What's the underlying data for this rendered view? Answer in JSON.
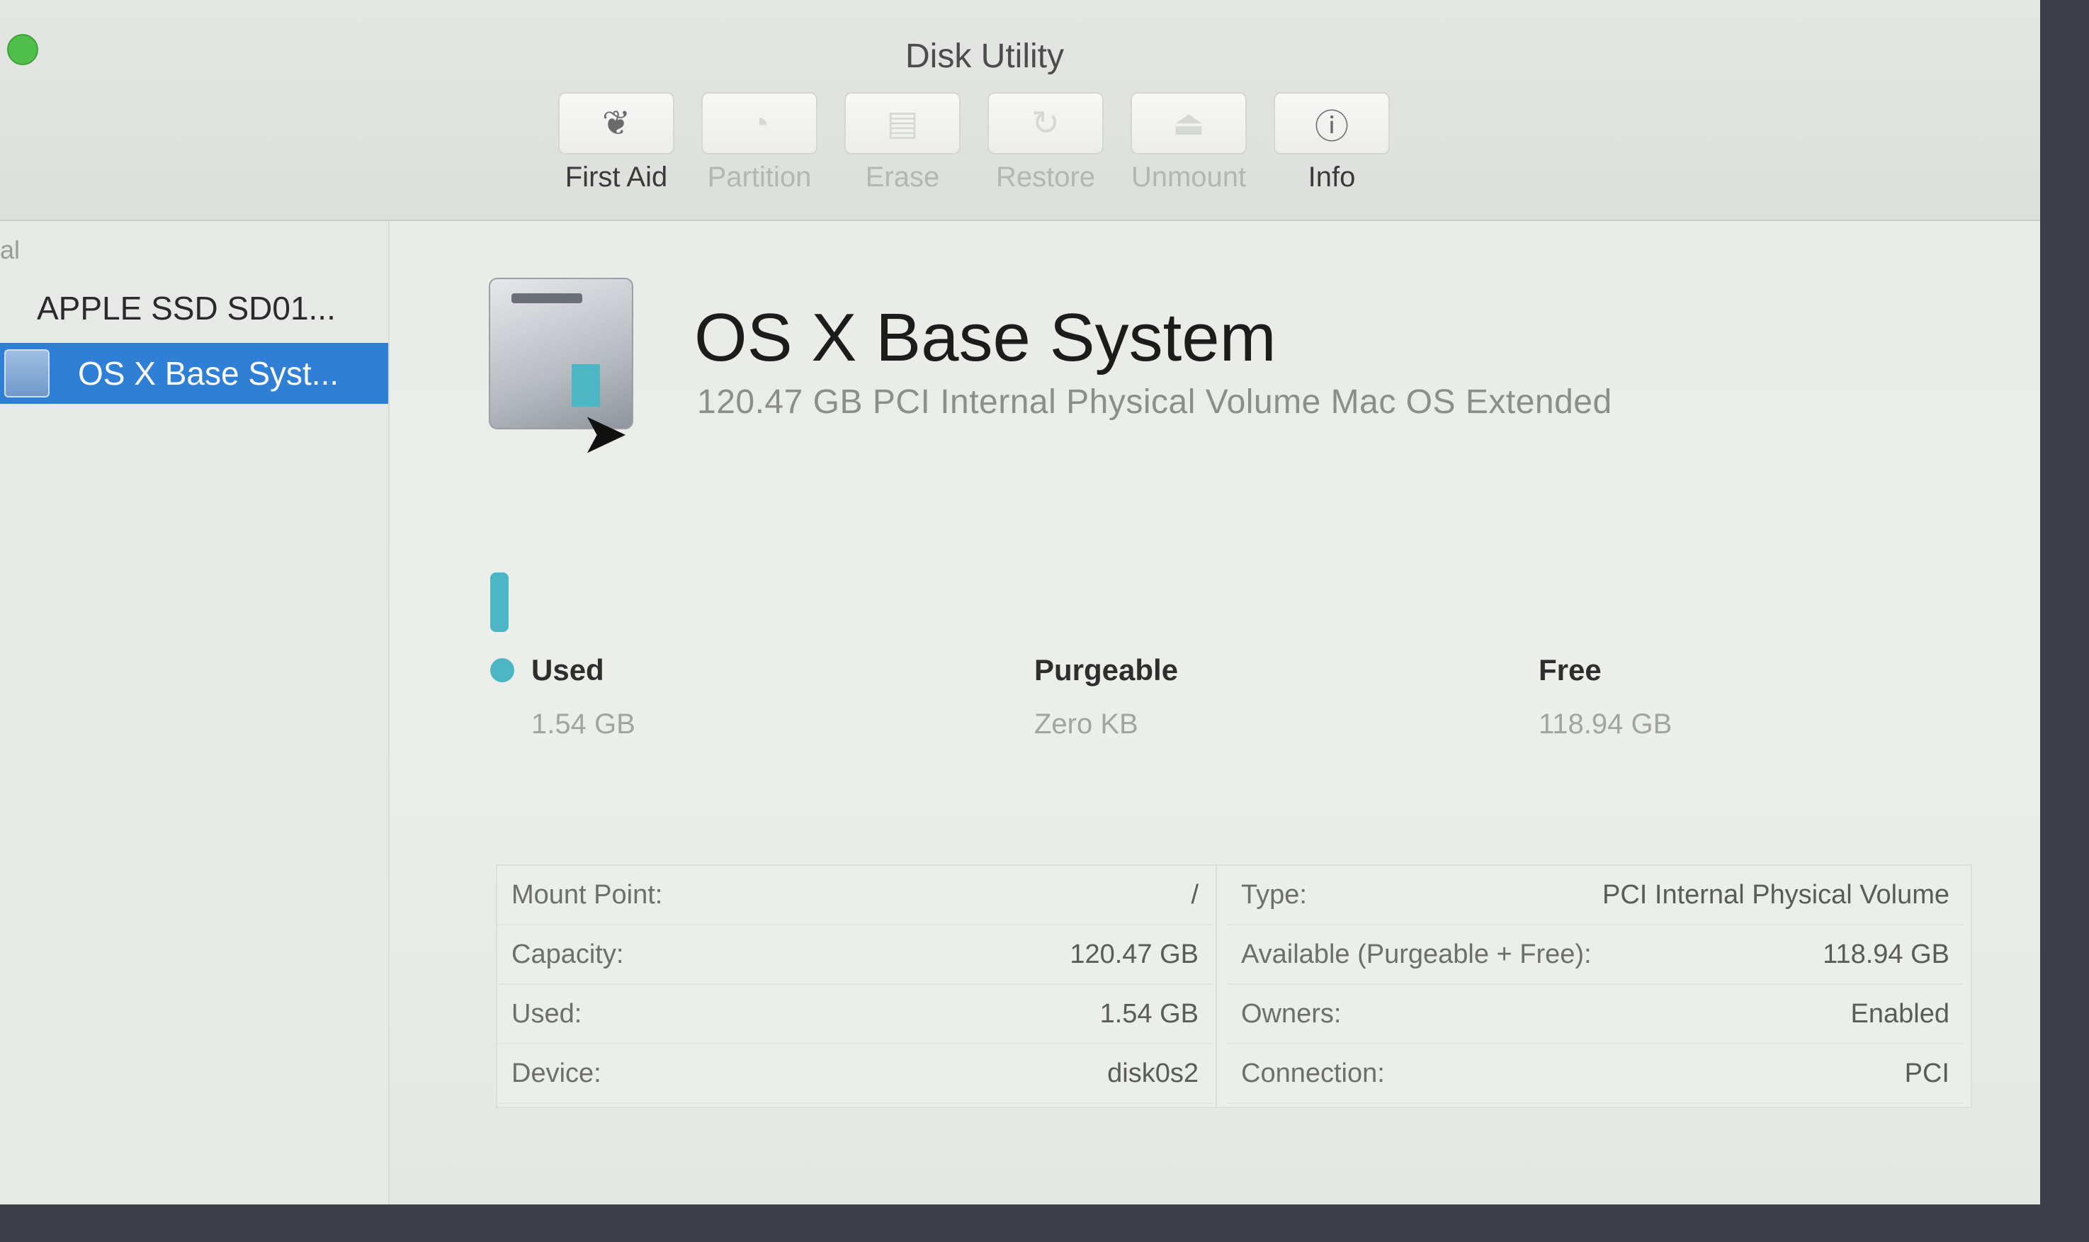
{
  "window": {
    "title": "Disk Utility"
  },
  "toolbar": {
    "items": [
      {
        "label": "First Aid",
        "icon": "stethoscope-icon",
        "enabled": true,
        "glyph": "❦"
      },
      {
        "label": "Partition",
        "icon": "partition-icon",
        "enabled": false,
        "glyph": "◔"
      },
      {
        "label": "Erase",
        "icon": "erase-icon",
        "enabled": false,
        "glyph": "▤"
      },
      {
        "label": "Restore",
        "icon": "restore-icon",
        "enabled": false,
        "glyph": "↻"
      },
      {
        "label": "Unmount",
        "icon": "eject-icon",
        "enabled": false,
        "glyph": "⏏"
      },
      {
        "label": "Info",
        "icon": "info-icon",
        "enabled": true,
        "glyph": "ⓘ"
      }
    ]
  },
  "sidebar": {
    "section": "al",
    "disk_label": "APPLE SSD SD01...",
    "volume_label": "OS X Base Syst..."
  },
  "volume": {
    "name": "OS X Base System",
    "description": "120.47 GB PCI Internal Physical Volume Mac OS Extended",
    "used_fraction": 0.0128
  },
  "stats": {
    "used_label": "Used",
    "used_value": "1.54 GB",
    "purgeable_label": "Purgeable",
    "purgeable_value": "Zero KB",
    "free_label": "Free",
    "free_value": "118.94 GB"
  },
  "details": {
    "left": [
      {
        "key": "Mount Point:",
        "value": "/"
      },
      {
        "key": "Capacity:",
        "value": "120.47 GB"
      },
      {
        "key": "Used:",
        "value": "1.54 GB"
      },
      {
        "key": "Device:",
        "value": "disk0s2"
      }
    ],
    "right": [
      {
        "key": "Type:",
        "value": "PCI Internal Physical Volume"
      },
      {
        "key": "Available (Purgeable + Free):",
        "value": "118.94 GB"
      },
      {
        "key": "Owners:",
        "value": "Enabled"
      },
      {
        "key": "Connection:",
        "value": "PCI"
      }
    ]
  },
  "colors": {
    "accent": "#2f7fd6",
    "used": "#4db6c4",
    "close_button": "#4fbf4a"
  }
}
